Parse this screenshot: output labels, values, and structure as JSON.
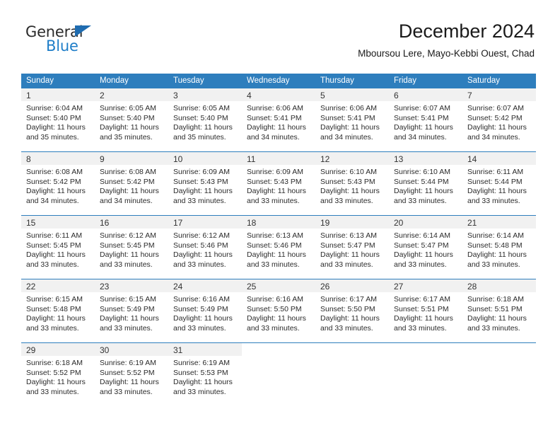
{
  "brand": {
    "name_part1": "General",
    "name_part2": "Blue",
    "triangle_color": "#1f6cb0",
    "blue_color": "#1f7ec8"
  },
  "header": {
    "title": "December 2024",
    "subtitle": "Mboursou Lere, Mayo-Kebbi Ouest, Chad"
  },
  "theme": {
    "header_blue": "#2e7ebd",
    "daynum_band": "#f1f1f1",
    "text": "#2b2b2b"
  },
  "calendar": {
    "weekdays": [
      "Sunday",
      "Monday",
      "Tuesday",
      "Wednesday",
      "Thursday",
      "Friday",
      "Saturday"
    ],
    "weeks": [
      [
        {
          "day": "1",
          "sunrise": "Sunrise: 6:04 AM",
          "sunset": "Sunset: 5:40 PM",
          "daylight1": "Daylight: 11 hours",
          "daylight2": "and 35 minutes."
        },
        {
          "day": "2",
          "sunrise": "Sunrise: 6:05 AM",
          "sunset": "Sunset: 5:40 PM",
          "daylight1": "Daylight: 11 hours",
          "daylight2": "and 35 minutes."
        },
        {
          "day": "3",
          "sunrise": "Sunrise: 6:05 AM",
          "sunset": "Sunset: 5:40 PM",
          "daylight1": "Daylight: 11 hours",
          "daylight2": "and 35 minutes."
        },
        {
          "day": "4",
          "sunrise": "Sunrise: 6:06 AM",
          "sunset": "Sunset: 5:41 PM",
          "daylight1": "Daylight: 11 hours",
          "daylight2": "and 34 minutes."
        },
        {
          "day": "5",
          "sunrise": "Sunrise: 6:06 AM",
          "sunset": "Sunset: 5:41 PM",
          "daylight1": "Daylight: 11 hours",
          "daylight2": "and 34 minutes."
        },
        {
          "day": "6",
          "sunrise": "Sunrise: 6:07 AM",
          "sunset": "Sunset: 5:41 PM",
          "daylight1": "Daylight: 11 hours",
          "daylight2": "and 34 minutes."
        },
        {
          "day": "7",
          "sunrise": "Sunrise: 6:07 AM",
          "sunset": "Sunset: 5:42 PM",
          "daylight1": "Daylight: 11 hours",
          "daylight2": "and 34 minutes."
        }
      ],
      [
        {
          "day": "8",
          "sunrise": "Sunrise: 6:08 AM",
          "sunset": "Sunset: 5:42 PM",
          "daylight1": "Daylight: 11 hours",
          "daylight2": "and 34 minutes."
        },
        {
          "day": "9",
          "sunrise": "Sunrise: 6:08 AM",
          "sunset": "Sunset: 5:42 PM",
          "daylight1": "Daylight: 11 hours",
          "daylight2": "and 34 minutes."
        },
        {
          "day": "10",
          "sunrise": "Sunrise: 6:09 AM",
          "sunset": "Sunset: 5:43 PM",
          "daylight1": "Daylight: 11 hours",
          "daylight2": "and 33 minutes."
        },
        {
          "day": "11",
          "sunrise": "Sunrise: 6:09 AM",
          "sunset": "Sunset: 5:43 PM",
          "daylight1": "Daylight: 11 hours",
          "daylight2": "and 33 minutes."
        },
        {
          "day": "12",
          "sunrise": "Sunrise: 6:10 AM",
          "sunset": "Sunset: 5:43 PM",
          "daylight1": "Daylight: 11 hours",
          "daylight2": "and 33 minutes."
        },
        {
          "day": "13",
          "sunrise": "Sunrise: 6:10 AM",
          "sunset": "Sunset: 5:44 PM",
          "daylight1": "Daylight: 11 hours",
          "daylight2": "and 33 minutes."
        },
        {
          "day": "14",
          "sunrise": "Sunrise: 6:11 AM",
          "sunset": "Sunset: 5:44 PM",
          "daylight1": "Daylight: 11 hours",
          "daylight2": "and 33 minutes."
        }
      ],
      [
        {
          "day": "15",
          "sunrise": "Sunrise: 6:11 AM",
          "sunset": "Sunset: 5:45 PM",
          "daylight1": "Daylight: 11 hours",
          "daylight2": "and 33 minutes."
        },
        {
          "day": "16",
          "sunrise": "Sunrise: 6:12 AM",
          "sunset": "Sunset: 5:45 PM",
          "daylight1": "Daylight: 11 hours",
          "daylight2": "and 33 minutes."
        },
        {
          "day": "17",
          "sunrise": "Sunrise: 6:12 AM",
          "sunset": "Sunset: 5:46 PM",
          "daylight1": "Daylight: 11 hours",
          "daylight2": "and 33 minutes."
        },
        {
          "day": "18",
          "sunrise": "Sunrise: 6:13 AM",
          "sunset": "Sunset: 5:46 PM",
          "daylight1": "Daylight: 11 hours",
          "daylight2": "and 33 minutes."
        },
        {
          "day": "19",
          "sunrise": "Sunrise: 6:13 AM",
          "sunset": "Sunset: 5:47 PM",
          "daylight1": "Daylight: 11 hours",
          "daylight2": "and 33 minutes."
        },
        {
          "day": "20",
          "sunrise": "Sunrise: 6:14 AM",
          "sunset": "Sunset: 5:47 PM",
          "daylight1": "Daylight: 11 hours",
          "daylight2": "and 33 minutes."
        },
        {
          "day": "21",
          "sunrise": "Sunrise: 6:14 AM",
          "sunset": "Sunset: 5:48 PM",
          "daylight1": "Daylight: 11 hours",
          "daylight2": "and 33 minutes."
        }
      ],
      [
        {
          "day": "22",
          "sunrise": "Sunrise: 6:15 AM",
          "sunset": "Sunset: 5:48 PM",
          "daylight1": "Daylight: 11 hours",
          "daylight2": "and 33 minutes."
        },
        {
          "day": "23",
          "sunrise": "Sunrise: 6:15 AM",
          "sunset": "Sunset: 5:49 PM",
          "daylight1": "Daylight: 11 hours",
          "daylight2": "and 33 minutes."
        },
        {
          "day": "24",
          "sunrise": "Sunrise: 6:16 AM",
          "sunset": "Sunset: 5:49 PM",
          "daylight1": "Daylight: 11 hours",
          "daylight2": "and 33 minutes."
        },
        {
          "day": "25",
          "sunrise": "Sunrise: 6:16 AM",
          "sunset": "Sunset: 5:50 PM",
          "daylight1": "Daylight: 11 hours",
          "daylight2": "and 33 minutes."
        },
        {
          "day": "26",
          "sunrise": "Sunrise: 6:17 AM",
          "sunset": "Sunset: 5:50 PM",
          "daylight1": "Daylight: 11 hours",
          "daylight2": "and 33 minutes."
        },
        {
          "day": "27",
          "sunrise": "Sunrise: 6:17 AM",
          "sunset": "Sunset: 5:51 PM",
          "daylight1": "Daylight: 11 hours",
          "daylight2": "and 33 minutes."
        },
        {
          "day": "28",
          "sunrise": "Sunrise: 6:18 AM",
          "sunset": "Sunset: 5:51 PM",
          "daylight1": "Daylight: 11 hours",
          "daylight2": "and 33 minutes."
        }
      ],
      [
        {
          "day": "29",
          "sunrise": "Sunrise: 6:18 AM",
          "sunset": "Sunset: 5:52 PM",
          "daylight1": "Daylight: 11 hours",
          "daylight2": "and 33 minutes."
        },
        {
          "day": "30",
          "sunrise": "Sunrise: 6:19 AM",
          "sunset": "Sunset: 5:52 PM",
          "daylight1": "Daylight: 11 hours",
          "daylight2": "and 33 minutes."
        },
        {
          "day": "31",
          "sunrise": "Sunrise: 6:19 AM",
          "sunset": "Sunset: 5:53 PM",
          "daylight1": "Daylight: 11 hours",
          "daylight2": "and 33 minutes."
        },
        {
          "day": "",
          "sunrise": "",
          "sunset": "",
          "daylight1": "",
          "daylight2": ""
        },
        {
          "day": "",
          "sunrise": "",
          "sunset": "",
          "daylight1": "",
          "daylight2": ""
        },
        {
          "day": "",
          "sunrise": "",
          "sunset": "",
          "daylight1": "",
          "daylight2": ""
        },
        {
          "day": "",
          "sunrise": "",
          "sunset": "",
          "daylight1": "",
          "daylight2": ""
        }
      ]
    ]
  }
}
